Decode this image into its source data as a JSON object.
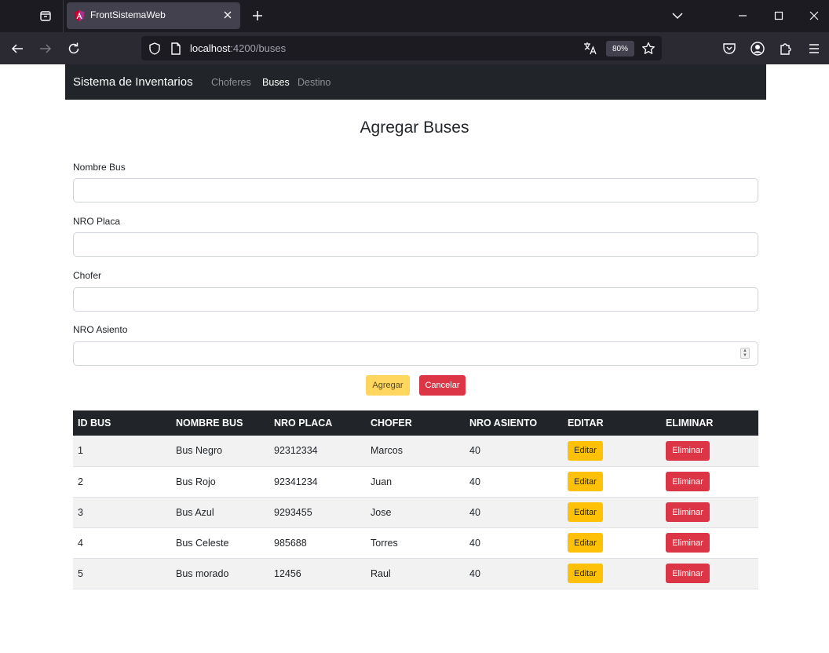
{
  "browser": {
    "tab_title": "FrontSistemaWeb",
    "url_host": "localhost",
    "url_rest": ":4200/buses",
    "zoom": "80%"
  },
  "app": {
    "brand": "Sistema de Inventarios",
    "nav": [
      "Choferes",
      "Buses",
      "Destino"
    ],
    "active_nav": "Buses"
  },
  "form": {
    "title": "Agregar Buses",
    "fields": [
      {
        "label": "Nombre Bus",
        "value": "",
        "placeholder": ""
      },
      {
        "label": "NRO Placa",
        "value": "",
        "placeholder": ""
      },
      {
        "label": "Chofer",
        "value": "",
        "placeholder": ""
      },
      {
        "label": "NRO Asiento",
        "value": "",
        "placeholder": ""
      }
    ],
    "submit_label": "Agregar",
    "cancel_label": "Cancelar"
  },
  "table": {
    "headers": [
      "ID BUS",
      "NOMBRE BUS",
      "NRO PLACA",
      "CHOFER",
      "NRO ASIENTO",
      "EDITAR",
      "ELIMINAR"
    ],
    "edit_label": "Editar",
    "delete_label": "Eliminar",
    "rows": [
      [
        "1",
        "Bus Negro",
        "92312334",
        "Marcos",
        "40"
      ],
      [
        "2",
        "Bus Rojo",
        "92341234",
        "Juan",
        "40"
      ],
      [
        "3",
        "Bus Azul",
        "9293455",
        "Jose",
        "40"
      ],
      [
        "4",
        "Bus Celeste",
        "985688",
        "Torres",
        "40"
      ],
      [
        "5",
        "Bus morado",
        "12456",
        "Raul",
        "40"
      ]
    ]
  },
  "colors": {
    "navbar": "#212529",
    "warning": "#ffc107",
    "danger": "#dc3545",
    "browser_dark": "#1c1b22"
  }
}
